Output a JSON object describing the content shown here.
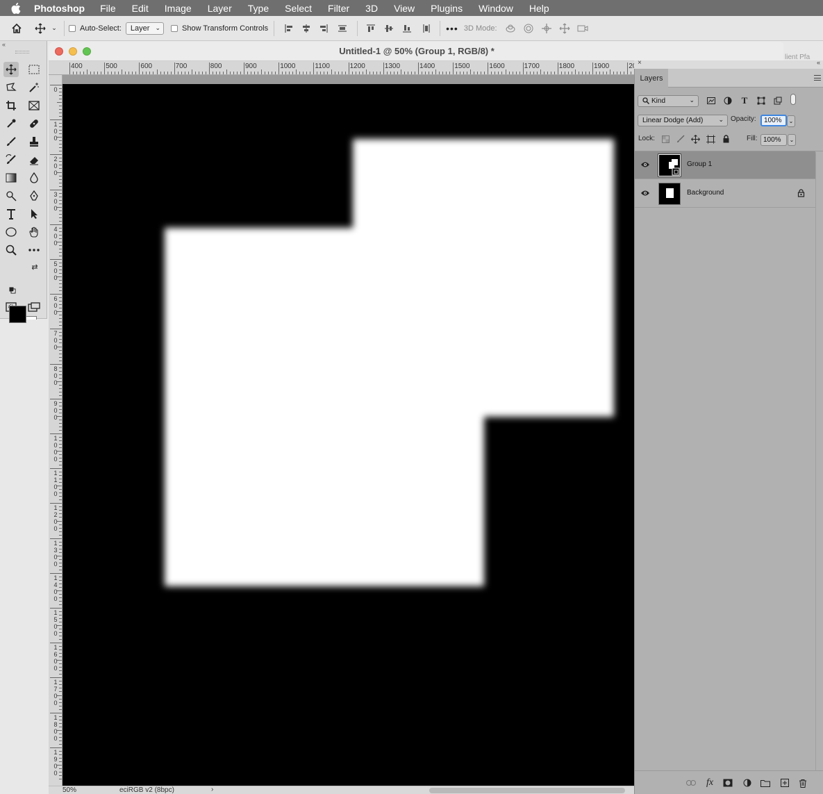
{
  "menubar": {
    "app_name": "Photoshop",
    "items": [
      "File",
      "Edit",
      "Image",
      "Layer",
      "Type",
      "Select",
      "Filter",
      "3D",
      "View",
      "Plugins",
      "Window",
      "Help"
    ]
  },
  "options_bar": {
    "auto_select_label": "Auto-Select:",
    "auto_select_value": "Layer",
    "show_transform_label": "Show Transform Controls",
    "mode_3d_label": "3D Mode:",
    "more": "•••"
  },
  "document": {
    "title": "Untitled-1 @ 50% (Group 1, RGB/8) *",
    "ruler_h_labels": [
      "400",
      "500",
      "600",
      "700",
      "800",
      "900",
      "1000",
      "1100",
      "1200",
      "1300",
      "1400",
      "1500",
      "1600",
      "1700",
      "1800",
      "1900",
      "20"
    ],
    "ruler_v_labels": [
      "0",
      "100",
      "200",
      "300",
      "400",
      "500",
      "600",
      "700",
      "800",
      "900",
      "1000",
      "1100",
      "1200",
      "1300",
      "1400",
      "1500",
      "1600",
      "1700",
      "1800",
      "1900"
    ],
    "background_color": "#000000",
    "shape_color": "#ffffff"
  },
  "status_bar": {
    "zoom": "50%",
    "profile": "eciRGB v2 (8bpc)",
    "arrow": "›"
  },
  "right_edge": {
    "partial_text": "lient  Pfa"
  },
  "layers_panel": {
    "tab_label": "Layers",
    "filter_label": "Kind",
    "blend_mode": "Linear Dodge (Add)",
    "opacity_label": "Opacity:",
    "opacity_value": "100%",
    "lock_label": "Lock:",
    "fill_label": "Fill:",
    "fill_value": "100%",
    "layers": [
      {
        "name": "Group 1",
        "selected": true,
        "visible": true,
        "locked": false
      },
      {
        "name": "Background",
        "selected": false,
        "visible": true,
        "locked": true
      }
    ]
  },
  "colors": {
    "foreground": "#000000",
    "background": "#ffffff",
    "accent": "#3d86e0"
  }
}
